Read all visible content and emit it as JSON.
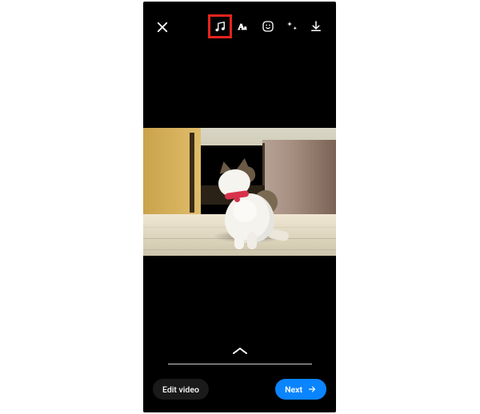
{
  "toolbar": {
    "close_label": "Close",
    "tools": {
      "music": "Music",
      "text": "Text",
      "sticker": "Sticker",
      "effects": "Effects",
      "download": "Download"
    },
    "highlighted_tool": "music"
  },
  "media": {
    "description": "A white cat with brown tabby patches on its head and back, wearing a red collar, sits on a tiled kitchen floor in front of a stainless-steel refrigerator and wooden cabinets, looking upward to the left."
  },
  "drawer": {
    "expand_label": "Expand"
  },
  "actions": {
    "edit_label": "Edit video",
    "next_label": "Next"
  },
  "colors": {
    "accent": "#0a84ff",
    "highlight": "#e5241d"
  }
}
